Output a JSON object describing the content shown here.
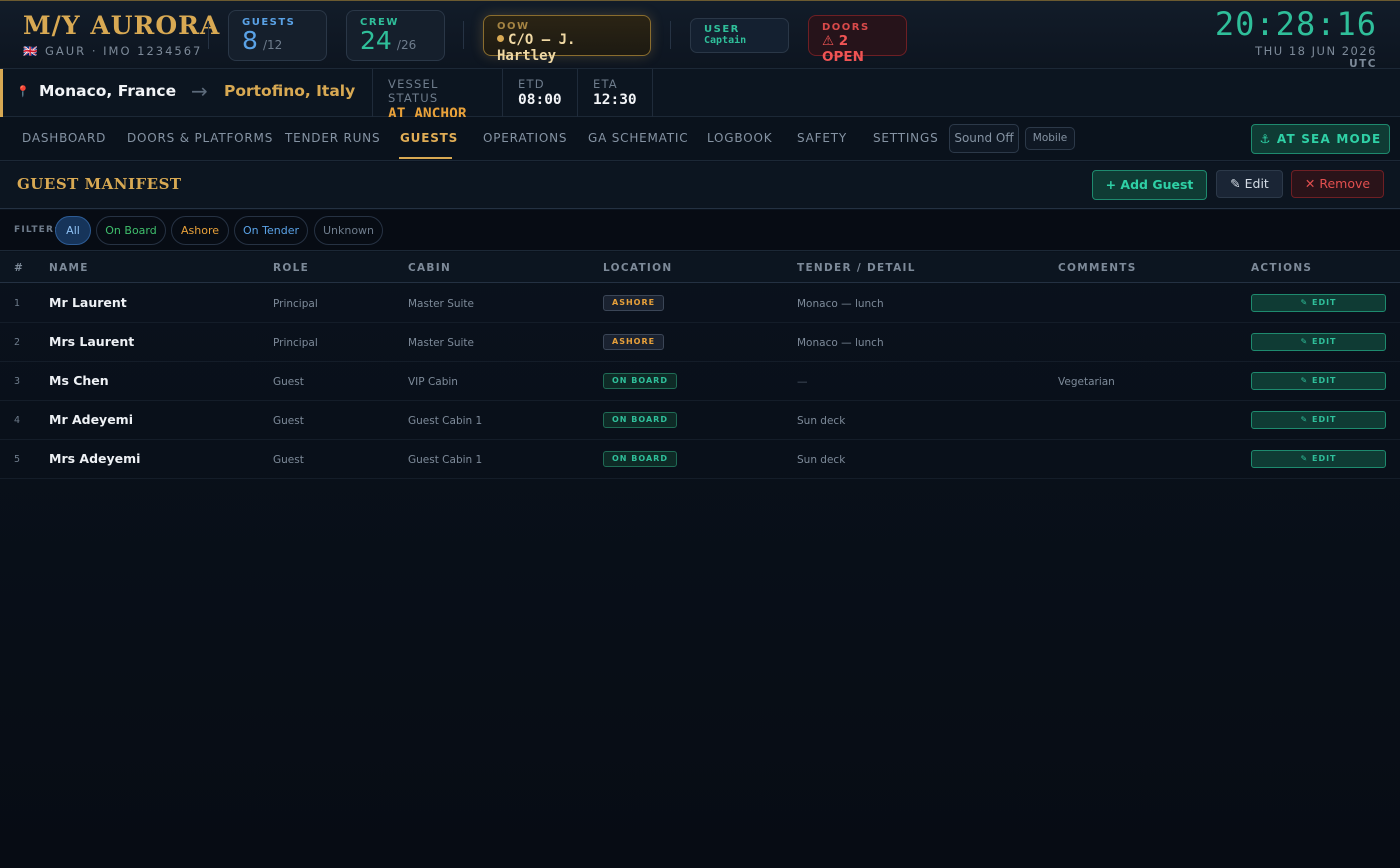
{
  "header": {
    "vessel_name": "M/Y AURORA",
    "vessel_sub": "🇬🇧 GAUR · IMO 1234567",
    "guests": {
      "label": "GUESTS",
      "count": "8",
      "capacity": "/12"
    },
    "crew": {
      "label": "CREW",
      "count": "24",
      "capacity": "/26"
    },
    "oow": {
      "label": "OOW",
      "value": "C/O — J. Hartley"
    },
    "user": {
      "label": "USER",
      "value": "Captain"
    },
    "doors": {
      "label": "DOORS",
      "value": "⚠ 2 OPEN"
    },
    "clock": {
      "time": "20:28:16",
      "date": "THU 18 JUN 2026",
      "tz": "UTC"
    }
  },
  "route": {
    "from": "Monaco, France",
    "arrow": "→",
    "to": "Portofino, Italy",
    "vessel_status_label": "VESSEL STATUS",
    "vessel_status": "AT ANCHOR",
    "etd_label": "ETD",
    "etd": "08:00",
    "eta_label": "ETA",
    "eta": "12:30"
  },
  "nav": {
    "items": [
      "DASHBOARD",
      "DOORS & PLATFORMS",
      "TENDER RUNS",
      "GUESTS",
      "OPERATIONS",
      "GA SCHEMATIC",
      "LOGBOOK",
      "SAFETY",
      "SETTINGS"
    ],
    "active": "GUESTS",
    "sound_btn": "Sound Off",
    "mobile_btn": "Mobile",
    "sea_mode_btn": "⚓ AT SEA MODE"
  },
  "manifest": {
    "title": "GUEST MANIFEST",
    "add_btn": "+ Add Guest",
    "edit_btn": "✎ Edit",
    "remove_btn": "✕ Remove"
  },
  "filter": {
    "label": "FILTER:",
    "chips": [
      "All",
      "On Board",
      "Ashore",
      "On Tender",
      "Unknown"
    ],
    "active": "All"
  },
  "table": {
    "headers": [
      "#",
      "NAME",
      "ROLE",
      "CABIN",
      "LOCATION",
      "TENDER / DETAIL",
      "COMMENTS",
      "ACTIONS"
    ],
    "edit_label": "✎ EDIT",
    "rows": [
      {
        "num": "1",
        "name": "Mr Laurent",
        "role": "Principal",
        "cabin": "Master Suite",
        "location": "ASHORE",
        "detail": "Monaco — lunch",
        "comment": ""
      },
      {
        "num": "2",
        "name": "Mrs Laurent",
        "role": "Principal",
        "cabin": "Master Suite",
        "location": "ASHORE",
        "detail": "Monaco — lunch",
        "comment": ""
      },
      {
        "num": "3",
        "name": "Ms Chen",
        "role": "Guest",
        "cabin": "VIP Cabin",
        "location": "ON BOARD",
        "detail": "—",
        "comment": "Vegetarian"
      },
      {
        "num": "4",
        "name": "Mr Adeyemi",
        "role": "Guest",
        "cabin": "Guest Cabin 1",
        "location": "ON BOARD",
        "detail": "Sun deck",
        "comment": ""
      },
      {
        "num": "5",
        "name": "Mrs Adeyemi",
        "role": "Guest",
        "cabin": "Guest Cabin 1",
        "location": "ON BOARD",
        "detail": "Sun deck",
        "comment": ""
      }
    ]
  },
  "colors": {
    "accent_gold": "#d8a953",
    "teal": "#2fbf9a",
    "alert_red": "#f05454",
    "guest_blue": "#5aa2e6",
    "status_orange": "#e8a13a",
    "background": "#070c14"
  }
}
